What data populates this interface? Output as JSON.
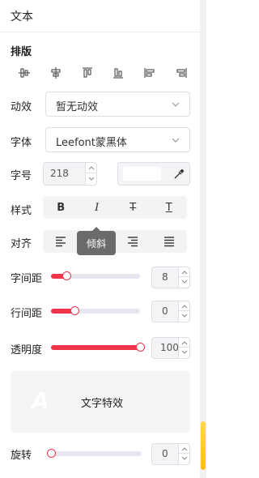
{
  "header": {
    "title": "文本"
  },
  "layout_section": {
    "title": "排版",
    "tools": [
      "align-vertical-center-icon",
      "align-horizontal-center-icon",
      "align-top-icon",
      "align-bottom-icon",
      "align-left-icon",
      "align-right-icon"
    ]
  },
  "animation": {
    "label": "动效",
    "value": "暂无动效"
  },
  "font": {
    "label": "字体",
    "value": "Leefont蒙黑体"
  },
  "size": {
    "label": "字号",
    "value": "218",
    "color": "#ffffff"
  },
  "style": {
    "label": "样式",
    "bold": "B",
    "italic": "I",
    "strike": "T",
    "underline": "T"
  },
  "align": {
    "label": "对齐",
    "tooltip": "倾斜"
  },
  "letter_spacing": {
    "label": "字间距",
    "value": "8",
    "fraction": 0.17
  },
  "line_spacing": {
    "label": "行间距",
    "value": "0",
    "fraction": 0.26
  },
  "opacity": {
    "label": "透明度",
    "value": "100",
    "fraction": 1.0
  },
  "effect": {
    "preview": "A",
    "label": "文字特效"
  },
  "rotation": {
    "label": "旋转",
    "value": "0",
    "fraction": 0.0
  },
  "colors": {
    "accent": "#f0344c",
    "scroll_thumb": "#fbbf1a"
  }
}
